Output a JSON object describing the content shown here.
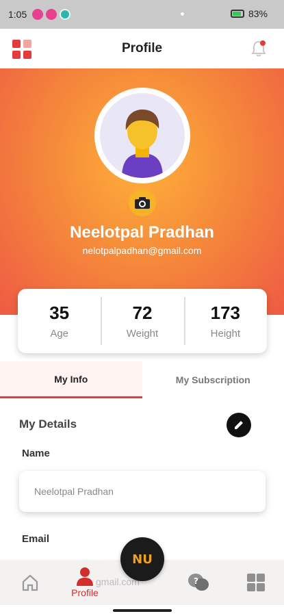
{
  "status_bar": {
    "time": "1:05",
    "battery": "83%"
  },
  "header": {
    "title": "Profile"
  },
  "profile": {
    "name": "Neelotpal Pradhan",
    "email": "nelotpalpadhan@gmail.com"
  },
  "stats": [
    {
      "value": "35",
      "label": "Age"
    },
    {
      "value": "72",
      "label": "Weight"
    },
    {
      "value": "173",
      "label": "Height"
    }
  ],
  "tabs": [
    {
      "label": "My Info",
      "active": true
    },
    {
      "label": "My Subscription",
      "active": false
    }
  ],
  "details": {
    "title": "My Details",
    "name_label": "Name",
    "name_value": "Neelotpal Pradhan",
    "email_label": "Email",
    "email_peek": "gmail.com"
  },
  "bottom_nav": {
    "profile_label": "Profile",
    "fab_logo": "NU"
  },
  "colors": {
    "accent": "#e23d3d",
    "hero_start": "#ffb03b",
    "hero_end": "#ee5a44",
    "camera": "#f7b327"
  },
  "icons": [
    "menu-grid-icon",
    "bell-icon",
    "camera-icon",
    "edit-pencil-icon",
    "home-icon",
    "person-icon",
    "support-chat-icon",
    "grid-more-icon"
  ]
}
